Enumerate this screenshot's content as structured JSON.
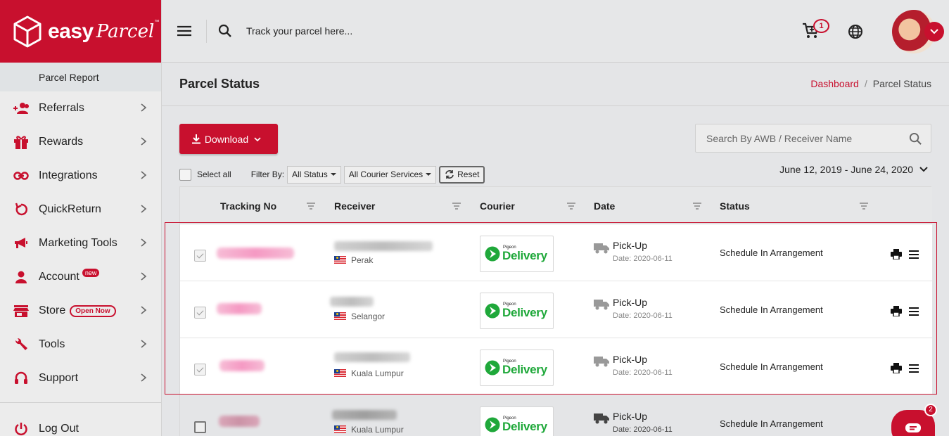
{
  "brand": {
    "word1": "easy",
    "word2": "Parcel",
    "tm": "™",
    "color": "#c8102e"
  },
  "sidebar": {
    "subitem": "Parcel Report",
    "items": [
      {
        "label": "Referrals",
        "icon": "referrals-icon"
      },
      {
        "label": "Rewards",
        "icon": "gift-icon"
      },
      {
        "label": "Integrations",
        "icon": "link-icon"
      },
      {
        "label": "QuickReturn",
        "icon": "return-icon"
      },
      {
        "label": "Marketing Tools",
        "icon": "megaphone-icon"
      },
      {
        "label": "Account",
        "icon": "user-icon",
        "badge": "new"
      },
      {
        "label": "Store",
        "icon": "store-icon",
        "badge": "Open Now"
      },
      {
        "label": "Tools",
        "icon": "wrench-icon"
      },
      {
        "label": "Support",
        "icon": "headset-icon"
      }
    ],
    "logout": "Log Out"
  },
  "topbar": {
    "track_placeholder": "Track your parcel here...",
    "cart_count": "1"
  },
  "page": {
    "title": "Parcel Status",
    "breadcrumb": {
      "link": "Dashboard",
      "separator": "/",
      "current": "Parcel Status"
    }
  },
  "toolbar": {
    "download_label": "Download",
    "search_placeholder": "Search By AWB / Receiver Name",
    "select_all": "Select all",
    "filter_by": "Filter By:",
    "status_filter": "All Status",
    "courier_filter": "All Courier Services",
    "reset_label": "Reset",
    "date_range": "June 12, 2019 - June 24, 2020"
  },
  "table": {
    "columns": [
      "Tracking No",
      "Receiver",
      "Courier",
      "Date",
      "Status"
    ],
    "rows": [
      {
        "state": "Perak",
        "courier_small": "Pigeon",
        "courier": "Delivery",
        "type": "Pick-Up",
        "date": "Date: 2020-06-11",
        "status": "Schedule In Arrangement",
        "checked": true
      },
      {
        "state": "Selangor",
        "courier_small": "Pigeon",
        "courier": "Delivery",
        "type": "Pick-Up",
        "date": "Date: 2020-06-11",
        "status": "Schedule In Arrangement",
        "checked": true
      },
      {
        "state": "Kuala Lumpur",
        "courier_small": "Pigeon",
        "courier": "Delivery",
        "type": "Pick-Up",
        "date": "Date: 2020-06-11",
        "status": "Schedule In Arrangement",
        "checked": true
      },
      {
        "state": "Kuala Lumpur",
        "courier_small": "Pigeon",
        "courier": "Delivery",
        "type": "Pick-Up",
        "date": "Date: 2020-06-11",
        "status": "Schedule In Arrangement",
        "checked": false
      }
    ]
  },
  "chat": {
    "badge": "2"
  }
}
